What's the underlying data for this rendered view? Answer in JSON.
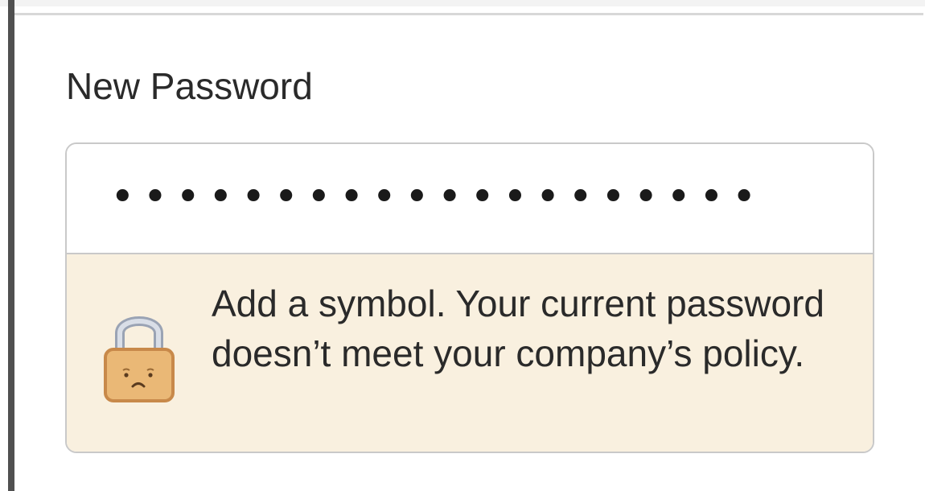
{
  "form": {
    "label": "New Password",
    "password_mask": "••••••••••••••••••••",
    "warning": {
      "icon": "sad-lock-icon",
      "message": "Add a symbol. Your current password doesn’t meet your company’s policy.",
      "background_color": "#f9f0df"
    }
  }
}
